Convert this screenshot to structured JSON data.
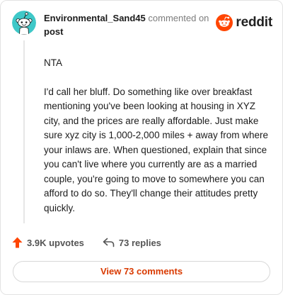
{
  "comment": {
    "author": "Environmental_Sand45",
    "action_text": "commented on",
    "target_link": "post",
    "avatar_icon": "snoo-avatar-icon",
    "body": {
      "verdict": "NTA",
      "paragraph": "I'd call her bluff. Do something like over breakfast mentioning you've been looking at housing in XYZ city, and the prices are really affordable. Just make sure xyz city is 1,000-2,000 miles + away from where your inlaws are. When questioned, explain that since you can't live where you currently are as a married couple, you're going to move to somewhere you can afford to do so. They'll change their attitudes pretty quickly."
    }
  },
  "brand": {
    "wordmark": "reddit",
    "icon": "reddit-logo-icon",
    "color": "#ff4500"
  },
  "stats": {
    "upvotes": "3.9K upvotes",
    "upvote_icon": "upvote-arrow-icon",
    "upvote_color": "#ff4500",
    "replies": "73 replies",
    "reply_icon": "reply-arrow-icon"
  },
  "actions": {
    "view_comments": "View 73 comments",
    "accent_color": "#d93a00"
  }
}
